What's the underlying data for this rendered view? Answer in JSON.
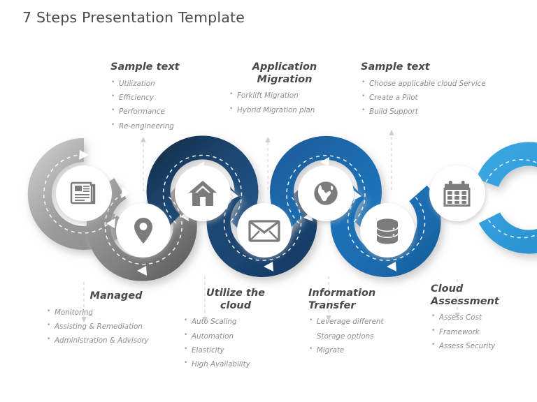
{
  "page": {
    "title": "7 Steps Presentation Template"
  },
  "theme": {
    "title_color": "#4a4a4a",
    "heading_color": "#494949",
    "body_color": "#8d8d8d",
    "icon_color": "#7c7c7c",
    "ring_colors": [
      "#9a9a9a",
      "#9a9a9a",
      "#1d4975",
      "#1d4975",
      "#1c6cb0",
      "#1c6cb0",
      "#2f9ad8"
    ],
    "ring_shadow": "#d9d9d9",
    "circle_fill": "#ffffff",
    "dash_color": "#ffffff",
    "connector_color": "#cccccc"
  },
  "steps": [
    {
      "index": 1,
      "icon": "newspaper-icon",
      "ring_color": "#9a9a9a",
      "position": "up"
    },
    {
      "index": 2,
      "icon": "location-pin-icon",
      "ring_color": "#9a9a9a",
      "position": "down"
    },
    {
      "index": 3,
      "icon": "home-icon",
      "ring_color": "#1d4975",
      "position": "up"
    },
    {
      "index": 4,
      "icon": "envelope-icon",
      "ring_color": "#1d4975",
      "position": "down"
    },
    {
      "index": 5,
      "icon": "globe-icon",
      "ring_color": "#1c6cb0",
      "position": "up"
    },
    {
      "index": 6,
      "icon": "database-icon",
      "ring_color": "#1c6cb0",
      "position": "down"
    },
    {
      "index": 7,
      "icon": "calendar-icon",
      "ring_color": "#2f9ad8",
      "position": "up"
    }
  ],
  "top_blocks": [
    {
      "heading": "Sample text",
      "items": [
        "Utilization",
        "Efficiency",
        "Performance",
        "Re-engineering"
      ]
    },
    {
      "heading": "Application\nMigration",
      "items": [
        "Forklift Migration",
        "Hybrid Migration plan"
      ]
    },
    {
      "heading": "Sample text",
      "items": [
        "Choose applicable cloud Service",
        "Create a Pilot",
        "Build Support"
      ]
    }
  ],
  "bottom_blocks": [
    {
      "heading": "Managed",
      "items": [
        "Monitoring",
        "Assisting & Remediation",
        "Administration & Advisory"
      ]
    },
    {
      "heading": "Utilize the\ncloud",
      "items": [
        "Auto Scaling",
        "Automation",
        "Elasticity",
        "High Availability"
      ]
    },
    {
      "heading": "Information\nTransfer",
      "items": [
        "Leverage different",
        "Storage options",
        "Migrate"
      ]
    },
    {
      "heading": "Cloud\nAssessment",
      "items": [
        "Assess Cost",
        "Framework",
        "Assess Security"
      ]
    }
  ]
}
